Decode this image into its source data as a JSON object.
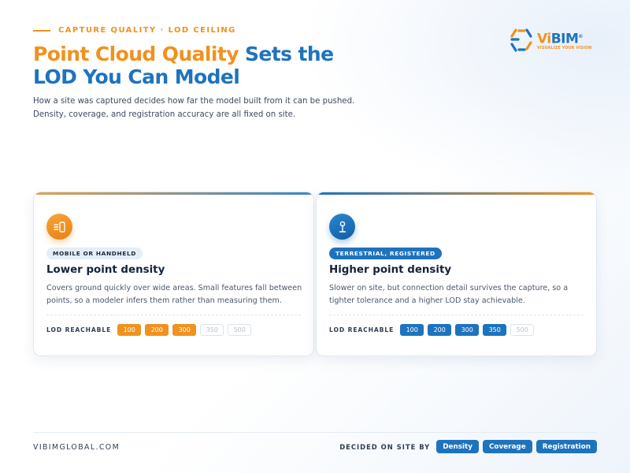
{
  "header": {
    "eyebrow": "CAPTURE QUALITY · LOD CEILING",
    "title_accent": "Point Cloud Quality",
    "title_rest": " Sets the LOD You Can Model",
    "subtitle": "How a site was captured decides how far the model built from it can be pushed. Density, coverage, and registration accuracy are all fixed on site."
  },
  "logo": {
    "brand_vi": "Vi",
    "brand_rest": "BIM",
    "registered": "®",
    "tagline": "VISUALIZE YOUR VISION"
  },
  "cards": [
    {
      "icon": "mobile-scanner-icon",
      "badge": "MOBILE OR HANDHELD",
      "heading": "Lower point density",
      "description": "Covers ground quickly over wide areas. Small features fall between points, so a modeler infers them rather than measuring them.",
      "lod_label": "LOD REACHABLE",
      "lods": [
        {
          "value": "100",
          "reachable": true
        },
        {
          "value": "200",
          "reachable": true
        },
        {
          "value": "300",
          "reachable": true
        },
        {
          "value": "350",
          "reachable": false
        },
        {
          "value": "500",
          "reachable": false
        }
      ]
    },
    {
      "icon": "tripod-scanner-icon",
      "badge": "TERRESTRIAL, REGISTERED",
      "heading": "Higher point density",
      "description": "Slower on site, but connection detail survives the capture, so a tighter tolerance and a higher LOD stay achievable.",
      "lod_label": "LOD REACHABLE",
      "lods": [
        {
          "value": "100",
          "reachable": true
        },
        {
          "value": "200",
          "reachable": true
        },
        {
          "value": "300",
          "reachable": true
        },
        {
          "value": "350",
          "reachable": true
        },
        {
          "value": "500",
          "reachable": false
        }
      ]
    }
  ],
  "footer": {
    "site": "VIBIMGLOBAL.COM",
    "decided_label": "DECIDED ON SITE BY",
    "tags": [
      "Density",
      "Coverage",
      "Registration"
    ]
  },
  "colors": {
    "accent_orange": "#f0921e",
    "brand_blue": "#1e73be",
    "chip_off": "#b9c3cf"
  }
}
